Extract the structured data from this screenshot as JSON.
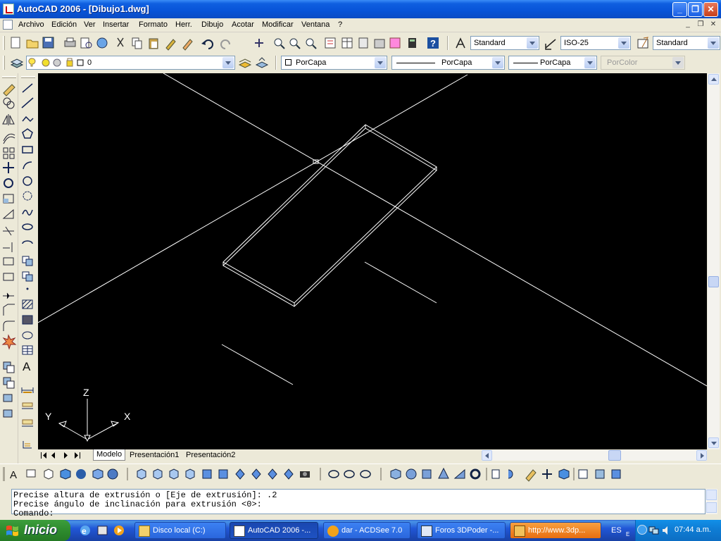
{
  "window": {
    "title": "AutoCAD 2006 - [Dibujo1.dwg]",
    "controls": [
      "_",
      "❐",
      "✕"
    ],
    "doc_controls": [
      "_",
      "❐",
      "✕"
    ]
  },
  "menu": [
    "Archivo",
    "Edición",
    "Ver",
    "Insertar",
    "Formato",
    "Herr.",
    "Dibujo",
    "Acotar",
    "Modificar",
    "Ventana",
    "?"
  ],
  "toolbar_styles": {
    "text_style": "Standard",
    "dim_style": "ISO-25",
    "table_style": "Standard"
  },
  "layers_bar": {
    "layer": "0",
    "color": "PorCapa",
    "linetype": "PorCapa",
    "lineweight": "PorCapa",
    "plotstyle": "PorColor"
  },
  "ucs": {
    "z": "Z",
    "x": "X",
    "y": "Y"
  },
  "tabs": [
    "Modelo",
    "Presentación1",
    "Presentación2"
  ],
  "command_lines": [
    "Precise altura de extrusión o [Eje de extrusión]: .2",
    "Precise ángulo de inclinación para extrusión <0>:",
    "Comando:"
  ],
  "taskbar": {
    "start": "Inicio",
    "tasks": [
      "Disco local (C:)",
      "AutoCAD 2006 -...",
      "dar - ACDSee 7.0",
      "Foros 3DPoder -...",
      "http://www.3dp..."
    ],
    "lang": "ES",
    "clock": "07:44 a.m."
  }
}
